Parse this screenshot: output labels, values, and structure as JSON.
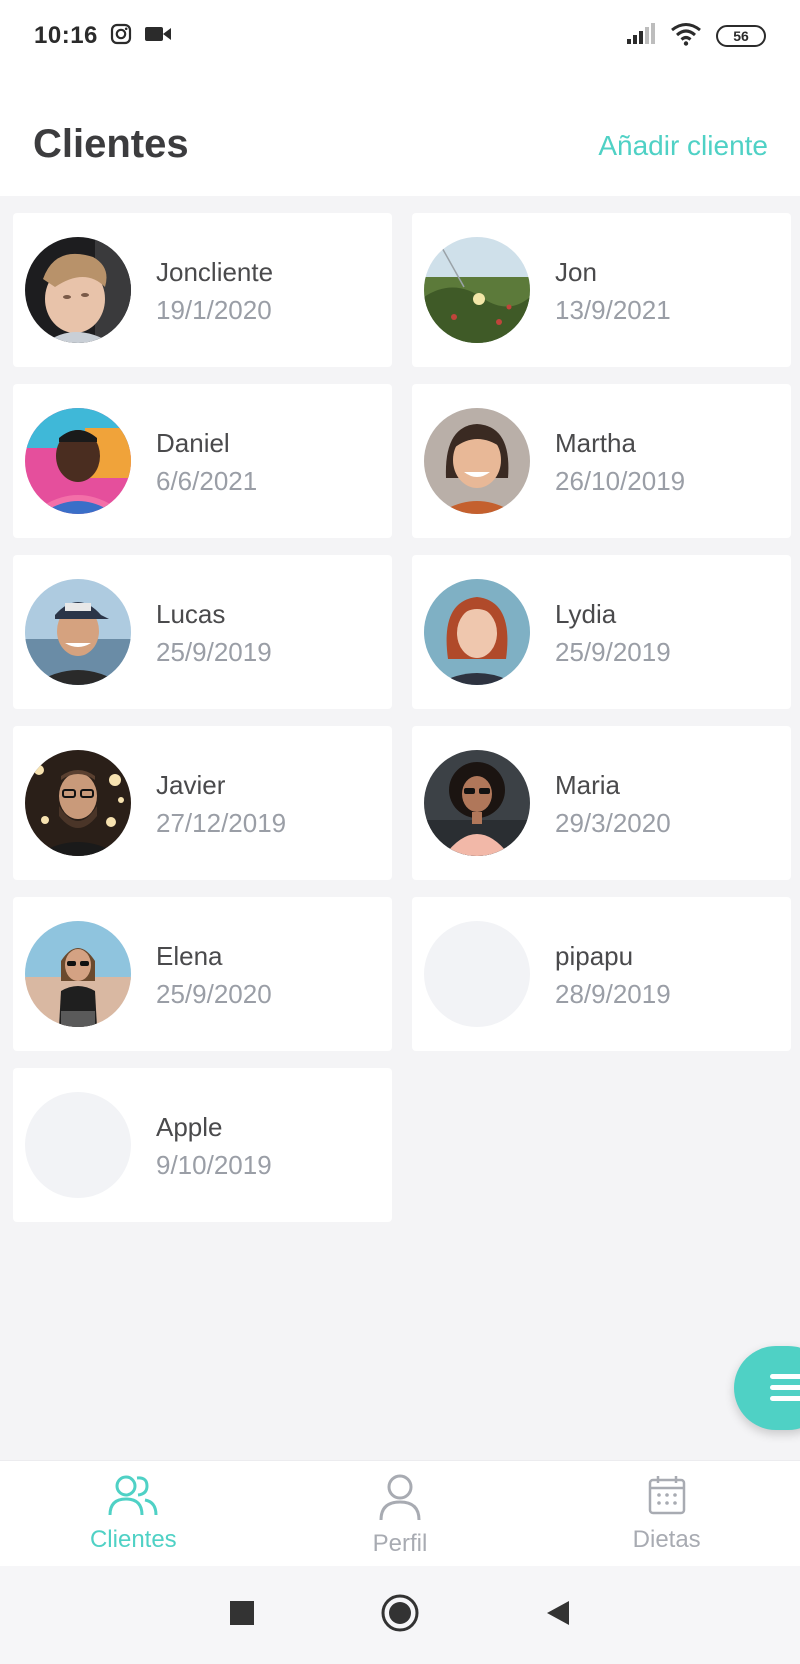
{
  "status_bar": {
    "time": "10:16",
    "battery": "56"
  },
  "header": {
    "title": "Clientes",
    "add_label": "Añadir cliente"
  },
  "clients": [
    {
      "name": "Joncliente",
      "date": "19/1/2020",
      "avatar": "photo-boy"
    },
    {
      "name": "Jon",
      "date": "13/9/2021",
      "avatar": "photo-flowers"
    },
    {
      "name": "Daniel",
      "date": "6/6/2021",
      "avatar": "photo-man-graffiti"
    },
    {
      "name": "Martha",
      "date": "26/10/2019",
      "avatar": "photo-woman-smiling"
    },
    {
      "name": "Lucas",
      "date": "25/9/2019",
      "avatar": "photo-man-cap"
    },
    {
      "name": "Lydia",
      "date": "25/9/2019",
      "avatar": "photo-woman-redhair"
    },
    {
      "name": "Javier",
      "date": "27/12/2019",
      "avatar": "photo-man-beard"
    },
    {
      "name": "Maria",
      "date": "29/3/2020",
      "avatar": "photo-woman-curly"
    },
    {
      "name": "Elena",
      "date": "25/9/2020",
      "avatar": "photo-woman-beach"
    },
    {
      "name": "pipapu",
      "date": "28/9/2019",
      "avatar": "empty"
    },
    {
      "name": "Apple",
      "date": "9/10/2019",
      "avatar": "empty"
    }
  ],
  "bottom_nav": [
    {
      "label": "Clientes",
      "icon": "users-icon",
      "active": true
    },
    {
      "label": "Perfil",
      "icon": "user-icon",
      "active": false
    },
    {
      "label": "Dietas",
      "icon": "calendar-icon",
      "active": false
    }
  ],
  "colors": {
    "accent": "#4fd1c5",
    "title": "#3c3c3e",
    "name": "#4a4a4c",
    "date": "#9a9ea6",
    "background": "#f4f4f6"
  }
}
